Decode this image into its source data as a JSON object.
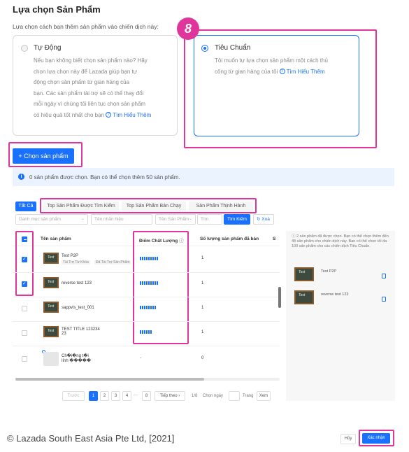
{
  "header": {
    "title": "Lựa chọn Sản Phẩm",
    "subtitle": "Lựa chọn cách bạn thêm sản phẩm vào chiến dịch này:"
  },
  "option_auto": {
    "title": "Tự Động",
    "desc_lines": [
      "Nếu bạn không biết chọn sản phẩm nào? Hãy",
      "chọn lựa chọn này để Lazada giúp bạn tự",
      "động chọn sản phẩm từ gian hàng của",
      "bạn. Các sản phẩm tài trợ sẽ có thể thay đổi",
      "mỗi ngày vì chúng tôi liên tục chọn sản phẩm"
    ],
    "desc_last": "có hiệu quả tốt nhất cho bạn",
    "link": "Tìm Hiểu Thêm"
  },
  "option_standard": {
    "title": "Tiêu Chuẩn",
    "desc_lines": [
      "Tôi muốn tự lựa chọn sản phẩm một cách thủ"
    ],
    "desc_last": "công từ gian hàng của tôi",
    "link": "Tìm Hiểu Thêm"
  },
  "step_badge": "8",
  "choose_button": "+ Chọn sản phẩm",
  "info": {
    "icon": "i",
    "text": "0 sản phẩm được chọn. Bạn có thể chọn thêm 50 sản phẩm."
  },
  "tabs": [
    "Tất Cả",
    "Top Sản Phẩm Được Tìm Kiếm",
    "Top Sản Phẩm Bán Chạy",
    "Sản Phẩm Thịnh Hành"
  ],
  "filters": {
    "category": "Danh mục sản phẩm",
    "brand": "Tên nhãn hiệu",
    "product_name": "Tên Sản Phẩm",
    "search_placeholder": "Tìm",
    "search_button": "Tìm Kiếm",
    "reset_button": "Xoá"
  },
  "table": {
    "headers": [
      "Tên sản phẩm",
      "Điểm Chất Lượng",
      "Số lượng sản phẩm đã bán",
      "S"
    ],
    "rows": [
      {
        "name": "Test P2P",
        "tags": [
          "Tài Trợ Từ Khóa",
          "Đã Tài Trợ Sản Phẩm"
        ],
        "quality": "▮▮▮▮▮▮▮▮▮",
        "sold": "1",
        "checked": true
      },
      {
        "name": "reverse test 123",
        "tags": [],
        "quality": "▮▮▮▮▮▮▮▮▮",
        "sold": "1",
        "checked": true
      },
      {
        "name": "sappvis_test_001",
        "tags": [],
        "quality": "▮▮▮▮▮▮▮▮",
        "sold": "1",
        "checked": false
      },
      {
        "name": "TEST TITLE 123234",
        "name2": "23",
        "tags": [],
        "quality": "▮▮▮▮▮▮",
        "sold": "1",
        "checked": false
      },
      {
        "name": "Ch�i�ng t�i",
        "name2": "lính �����",
        "tags": [],
        "quality": "-",
        "sold": "0",
        "checked": false
      }
    ]
  },
  "pager": {
    "prev": "Trước",
    "pages": [
      "1",
      "2",
      "3",
      "4",
      "···",
      "8"
    ],
    "next": "Tiếp theo",
    "total": "1/8",
    "goto": "Chọn ngày",
    "page_word": "Trang",
    "go": "Xem"
  },
  "side_panel": {
    "note": "2 sản phẩm đã được chọn. Bạn có thể chọn thêm đến 48 sản phẩm cho chiến dịch này. Bạn có thể chọn tối đa 100 sản phẩm cho các chiến dịch Tiêu Chuẩn.",
    "items": [
      "Test P2P",
      "reverse test 123"
    ]
  },
  "footer": {
    "copyright": "© Lazada South East Asia Pte Ltd, [2021]",
    "cancel": "Hủy",
    "confirm": "Xác nhận"
  },
  "colors": {
    "primary": "#1a71ff",
    "highlight": "#e0359b"
  }
}
